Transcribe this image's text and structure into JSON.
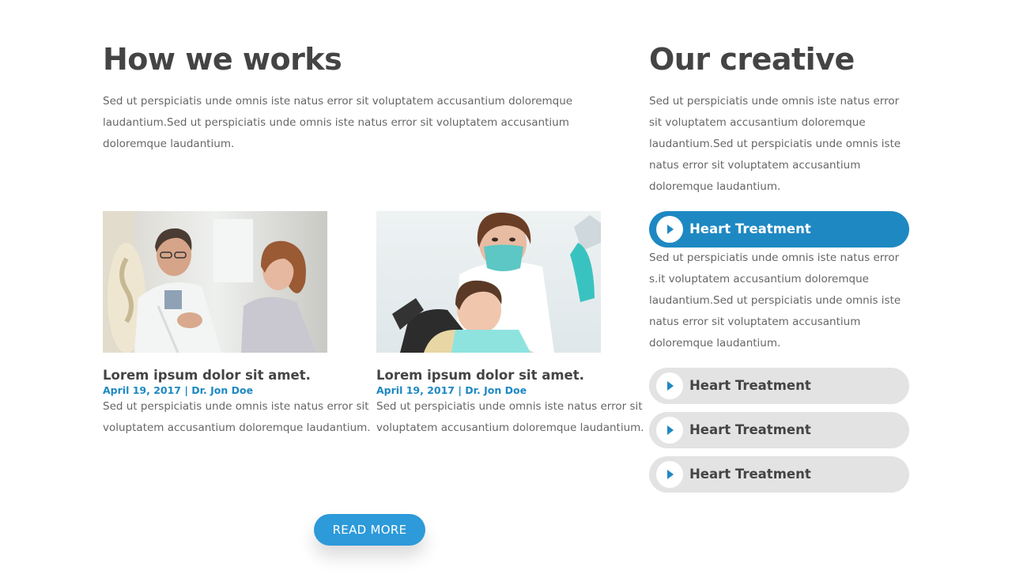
{
  "how": {
    "title": "How we works",
    "text": "Sed ut perspiciatis unde omnis iste natus error sit voluptatem accusantium doloremque laudantium.Sed ut perspiciatis unde omnis iste natus error sit voluptatem accusantium doloremque laudantium."
  },
  "posts": [
    {
      "title": "Lorem ipsum dolor sit amet.",
      "meta": "April 19, 2017 | Dr. Jon Doe",
      "excerpt": "Sed ut perspiciatis unde omnis iste natus error sit voluptatem accusantium doloremque laudantium."
    },
    {
      "title": "Lorem ipsum dolor sit amet.",
      "meta": "April 19, 2017 | Dr. Jon Doe",
      "excerpt": "Sed ut perspiciatis unde omnis iste natus error sit voluptatem accusantium doloremque laudantium."
    }
  ],
  "read_more": "READ MORE",
  "creative": {
    "title": "Our creative",
    "text": "Sed ut perspiciatis unde omnis iste natus error sit voluptatem accusantium doloremque laudantium.Sed ut perspiciatis unde omnis iste natus error sit voluptatem accusantium doloremque laudantium."
  },
  "accordion": {
    "items": [
      {
        "label": "Heart Treatment",
        "active": true
      },
      {
        "label": "Heart Treatment",
        "active": false
      },
      {
        "label": "Heart Treatment",
        "active": false
      },
      {
        "label": "Heart Treatment",
        "active": false
      }
    ],
    "open_text": "Sed ut perspiciatis unde omnis iste natus error s.it voluptatem accusantium doloremque laudantium.Sed ut perspiciatis unde omnis iste natus error sit voluptatem accusantium doloremque laudantium."
  },
  "colors": {
    "accent": "#1e88c2",
    "button": "#2d9ad9",
    "inactive_tab": "#e3e3e3",
    "heading": "#444444"
  },
  "icons": {
    "accordion": "play-triangle-icon"
  }
}
